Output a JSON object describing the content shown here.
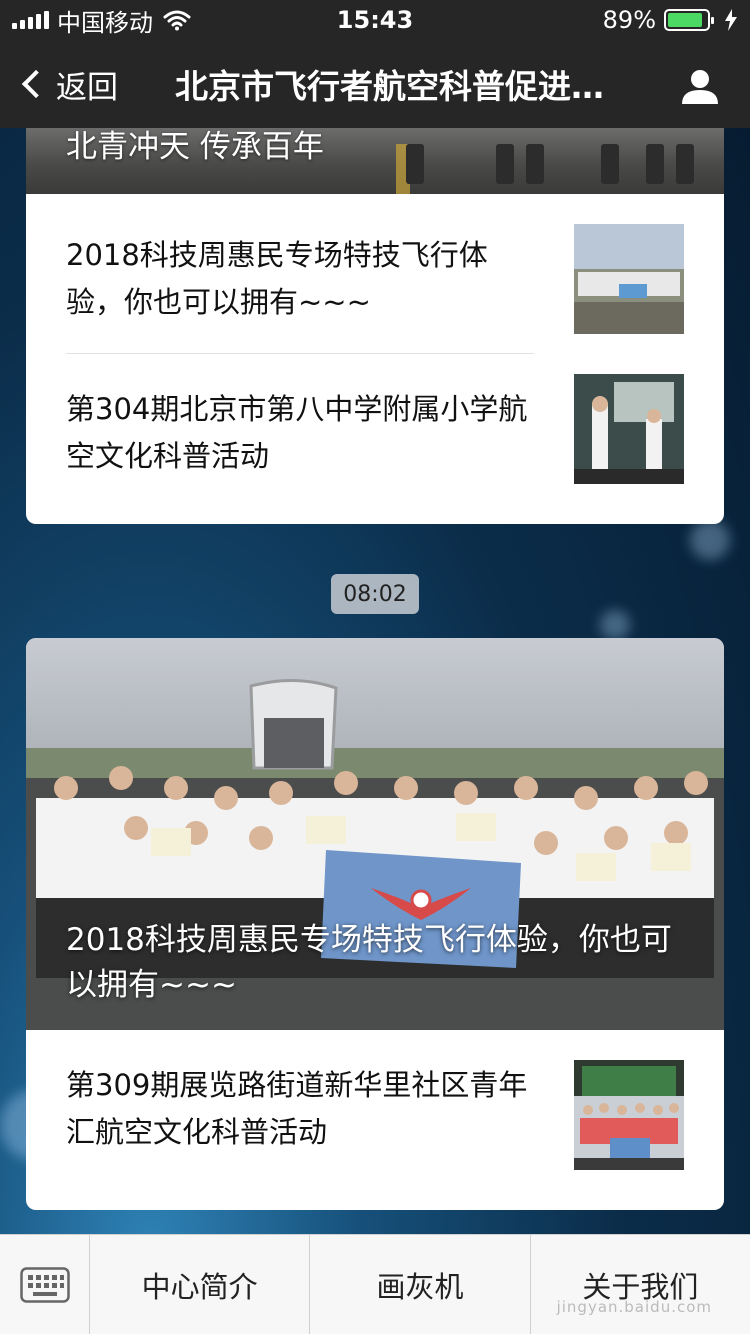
{
  "status_bar": {
    "carrier": "中国移动",
    "time": "15:43",
    "battery_percent": "89%",
    "battery_level": 0.89,
    "icons": [
      "signal-icon",
      "wifi-icon",
      "battery-icon",
      "charging-icon"
    ]
  },
  "nav": {
    "back_label": "返回",
    "title": "北京市飞行者航空科普促进中心",
    "icons": [
      "chevron-left-icon",
      "profile-icon"
    ]
  },
  "message_group_1": {
    "cover_title": "北青冲天 传承百年",
    "items": [
      {
        "title": "2018科技周惠民专场特技飞行体验，你也可以拥有~~~"
      },
      {
        "title": "第304期北京市第八中学附属小学航空文化科普活动"
      }
    ]
  },
  "timestamp": "08:02",
  "message_group_2": {
    "cover_title": "2018科技周惠民专场特技飞行体验，你也可以拥有~~~",
    "items": [
      {
        "title": "第309期展览路街道新华里社区青年汇航空文化科普活动"
      }
    ]
  },
  "bottom_menu": {
    "items": [
      "中心简介",
      "画灰机",
      "关于我们"
    ],
    "icons": [
      "keyboard-icon"
    ]
  },
  "watermark": "jingyan.baidu.com",
  "colors": {
    "bar_bg": "#262626",
    "battery_green": "#4cd964",
    "card_bg": "#ffffff",
    "menu_bg": "#f7f7f8"
  }
}
